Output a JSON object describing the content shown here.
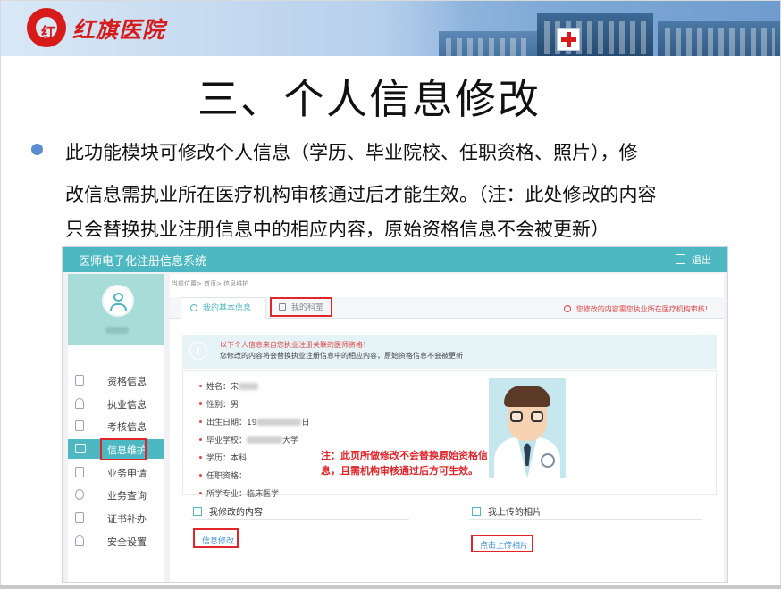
{
  "banner": {
    "logo_mark": "红",
    "hospital_name": "红旗医院",
    "colors": {
      "brand_red": "#d71b1b",
      "sky": "#b7d0ec"
    }
  },
  "slide": {
    "title": "三、个人信息修改",
    "paragraph_lines": [
      "此功能模块可修改个人信息（学历、毕业院校、任职资格、照片），修",
      "改信息需执业所在医疗机构审核通过后才能生效。（注：此处修改的内容",
      "只会替换执业注册信息中的相应内容，原始资格信息不会被更新）"
    ]
  },
  "app": {
    "title": "医师电子化注册信息系统",
    "logout_label": "退出",
    "accent": "#4db8c1",
    "sidebar": {
      "items": [
        {
          "label": "资格信息",
          "icon": "document-icon"
        },
        {
          "label": "执业信息",
          "icon": "headset-icon"
        },
        {
          "label": "考核信息",
          "icon": "document-icon"
        },
        {
          "label": "信息维护",
          "icon": "id-card-icon",
          "active": true
        },
        {
          "label": "业务申请",
          "icon": "edit-icon"
        },
        {
          "label": "业务查询",
          "icon": "search-icon"
        },
        {
          "label": "证书补办",
          "icon": "certificate-icon"
        },
        {
          "label": "安全设置",
          "icon": "user-lock-icon"
        }
      ]
    },
    "breadcrumb": "当前位置> 首页> 信息维护",
    "tabs": [
      {
        "label": "我的基本信息",
        "icon": "user-icon"
      },
      {
        "label": "我的科室",
        "icon": "plus-square-icon"
      }
    ],
    "tab_notice": "您修改的内容需您执业所在医疗机构审核!",
    "alert": {
      "line1": "以下个人信息来自您执业注册关联的医师资格！",
      "line2": "您修改的内容将会替换执业注册信息中的相应内容，原始资格信息不会被更新"
    },
    "fields": [
      {
        "label": "姓名：",
        "value": "宋"
      },
      {
        "label": "性别：",
        "value": "男"
      },
      {
        "label": "出生日期：",
        "value": "19",
        "suffix": "日"
      },
      {
        "label": "毕业学校：",
        "value": "",
        "suffix": "大学"
      },
      {
        "label": "学历：",
        "value": "本科"
      },
      {
        "label": "任职资格：",
        "value": ""
      },
      {
        "label": "所学专业：",
        "value": "临床医学"
      }
    ],
    "note": "注：此页所做修改不会替换原始资格信息，且需机构审核通过后方可生效。",
    "sections": {
      "modified": {
        "title": "我修改的内容",
        "link": "信息修改"
      },
      "photo": {
        "title": "我上传的相片",
        "link": "点击上传相片"
      }
    }
  }
}
